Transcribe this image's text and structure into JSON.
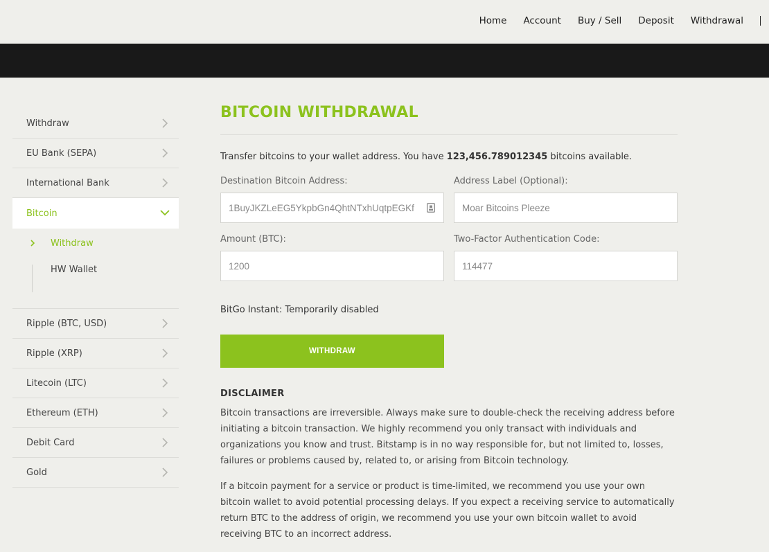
{
  "nav": {
    "links": [
      "Home",
      "Account",
      "Buy / Sell",
      "Deposit",
      "Withdrawal"
    ]
  },
  "sidebar": {
    "items_top": [
      {
        "label": "Withdraw"
      },
      {
        "label": "EU Bank (SEPA)"
      },
      {
        "label": "International Bank"
      }
    ],
    "active": {
      "label": "Bitcoin"
    },
    "sub_items": [
      {
        "label": "Withdraw",
        "active": true
      },
      {
        "label": "HW Wallet",
        "active": false
      }
    ],
    "items_bottom": [
      {
        "label": "Ripple (BTC, USD)"
      },
      {
        "label": "Ripple (XRP)"
      },
      {
        "label": "Litecoin (LTC)"
      },
      {
        "label": "Ethereum (ETH)"
      },
      {
        "label": "Debit Card"
      },
      {
        "label": "Gold"
      }
    ]
  },
  "main": {
    "title": "BITCOIN WITHDRAWAL",
    "intro_prefix": "Transfer bitcoins to your wallet address. You have ",
    "balance": "123,456.789012345",
    "intro_suffix": " bitcoins available.",
    "fields": {
      "address": {
        "label": "Destination Bitcoin Address:",
        "value": "1BuyJKZLeEG5YkpbGn4QhtNTxhUqtpEGKf"
      },
      "address_label": {
        "label": "Address Label (Optional):",
        "value": "Moar Bitcoins Pleeze"
      },
      "amount": {
        "label": "Amount (BTC):",
        "value": "1200"
      },
      "two_factor": {
        "label": "Two-Factor Authentication Code:",
        "value": "114477"
      }
    },
    "bitgo_note": "BitGo Instant: Temporarily disabled",
    "withdraw_button": "WITHDRAW",
    "disclaimer_title": "DISCLAIMER",
    "disclaimer_p1": "Bitcoin transactions are irreversible. Always make sure to double-check the receiving address before initiating a bitcoin transaction. We highly recommend you only transact with individuals and organizations you know and trust. Bitstamp is in no way responsible for, but not limited to, losses, failures or problems caused by, related to, or arising from Bitcoin technology.",
    "disclaimer_p2": "If a bitcoin payment for a service or product is time-limited, we recommend you use your own bitcoin wallet to avoid potential processing delays. If you expect a receiving service to automatically return BTC to the address of origin, we recommend you use your own bitcoin wallet to avoid receiving BTC to an incorrect address."
  },
  "colors": {
    "accent": "#8cc21e",
    "background": "#efefeb",
    "header_bar": "#191919"
  }
}
